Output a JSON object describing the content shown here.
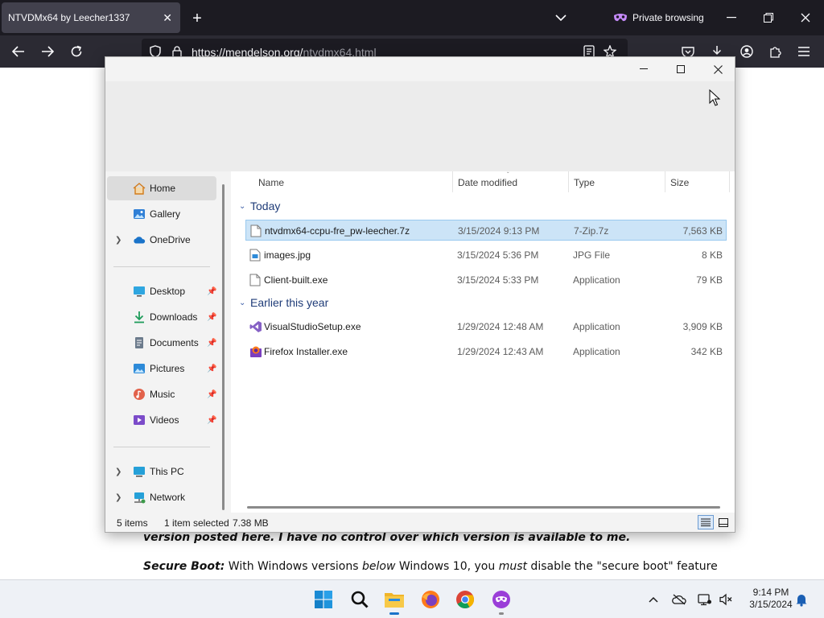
{
  "browser": {
    "tab_title": "NTVDMx64 by Leecher1337",
    "private_label": "Private browsing",
    "url_host_part": "https://mendelson.org/",
    "url_path_part": "ntvdmx64.html"
  },
  "page_behind": {
    "line1": "version posted here. I have no control over which version is available to me.",
    "line2_bold": "Secure Boot:",
    "line2_text1": " With Windows versions ",
    "line2_italic1": "below",
    "line2_text2": " Windows 10, you ",
    "line2_italic2": "must",
    "line2_text3": " disable the \"secure boot\" feature"
  },
  "explorer": {
    "nav": {
      "home": "Home",
      "gallery": "Gallery",
      "onedrive": "OneDrive",
      "desktop": "Desktop",
      "downloads": "Downloads",
      "documents": "Documents",
      "pictures": "Pictures",
      "music": "Music",
      "videos": "Videos",
      "thispc": "This PC",
      "network": "Network"
    },
    "columns": {
      "name": "Name",
      "date": "Date modified",
      "type": "Type",
      "size": "Size"
    },
    "groups": {
      "today": "Today",
      "earlier": "Earlier this year"
    },
    "files": [
      {
        "name": "ntvdmx64-ccpu-fre_pw-leecher.7z",
        "date": "3/15/2024 9:13 PM",
        "type": "7-Zip.7z",
        "size": "7,563 KB",
        "icon": "archive-file-icon"
      },
      {
        "name": "images.jpg",
        "date": "3/15/2024 5:36 PM",
        "type": "JPG File",
        "size": "8 KB",
        "icon": "image-file-icon"
      },
      {
        "name": "Client-built.exe",
        "date": "3/15/2024 5:33 PM",
        "type": "Application",
        "size": "79 KB",
        "icon": "exe-file-icon"
      },
      {
        "name": "VisualStudioSetup.exe",
        "date": "1/29/2024 12:48 AM",
        "type": "Application",
        "size": "3,909 KB",
        "icon": "visual-studio-icon"
      },
      {
        "name": "Firefox Installer.exe",
        "date": "1/29/2024 12:43 AM",
        "type": "Application",
        "size": "342 KB",
        "icon": "firefox-installer-icon"
      }
    ],
    "status": {
      "items": "5 items",
      "selected": "1 item selected",
      "selected_size": "7.38 MB"
    }
  },
  "taskbar": {
    "time": "9:14 PM",
    "date": "3/15/2024"
  },
  "colors": {
    "selection": "#cce4f7",
    "group_header": "#1f3c78",
    "browser_dark": "#1c1b22",
    "private_purple": "#8f3fd1"
  }
}
